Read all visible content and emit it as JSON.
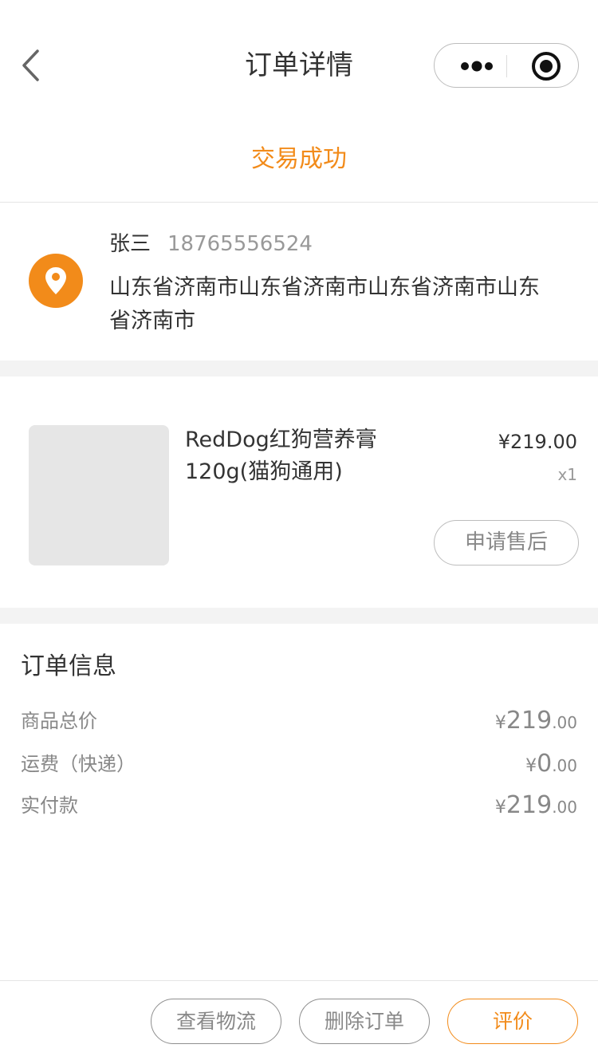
{
  "nav": {
    "title": "订单详情"
  },
  "status": "交易成功",
  "address": {
    "name": "张三",
    "phone": "18765556524",
    "detail": "山东省济南市山东省济南市山东省济南市山东省济南市"
  },
  "goods": {
    "name": "RedDog红狗营养膏120g(猫狗通用)",
    "price": "¥219.00",
    "quantity": "x1",
    "after_sale_label": "申请售后"
  },
  "order_info": {
    "title": "订单信息",
    "rows": [
      {
        "label": "商品总价",
        "yen": "¥",
        "int": "219",
        "dec": ".00"
      },
      {
        "label": "运费（快递）",
        "yen": "¥",
        "int": "0",
        "dec": ".00"
      },
      {
        "label": "实付款",
        "yen": "¥",
        "int": "219",
        "dec": ".00"
      }
    ]
  },
  "footer": {
    "logistics_label": "查看物流",
    "delete_label": "删除订单",
    "review_label": "评价"
  },
  "colors": {
    "accent": "#f28b1a"
  },
  "icons": {
    "back": "chevron-left-icon",
    "more": "more-dots-icon",
    "close": "record-close-icon",
    "location": "location-pin-icon"
  }
}
